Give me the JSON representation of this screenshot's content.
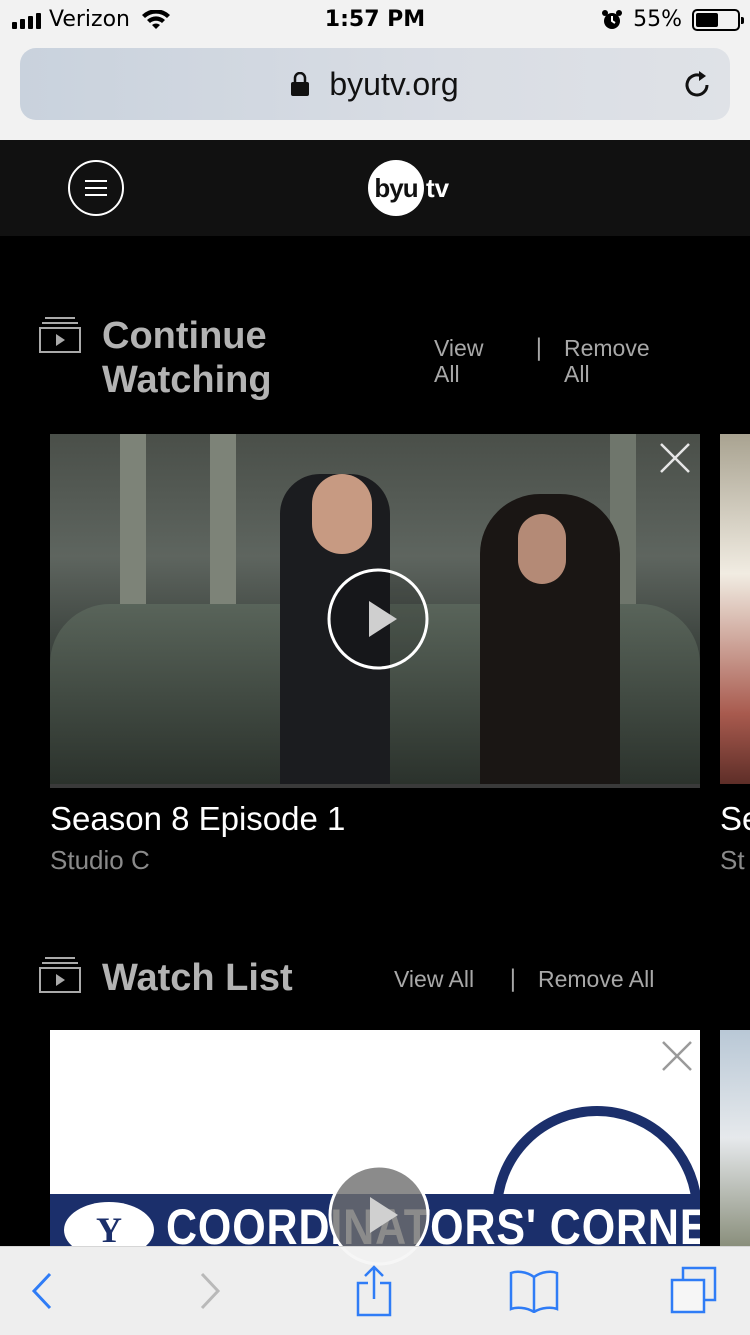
{
  "status_bar": {
    "carrier": "Verizon",
    "time": "1:57 PM",
    "battery_percent": "55%",
    "battery_level": 0.55
  },
  "browser": {
    "url": "byutv.org"
  },
  "header": {
    "logo_circle": "byu",
    "logo_suffix": "tv"
  },
  "continue_watching": {
    "title_line1": "Continue",
    "title_line2": "Watching",
    "view_all_line1": "View",
    "view_all_line2": "All",
    "separator": "|",
    "remove_all_line1": "Remove",
    "remove_all_line2": "All",
    "card": {
      "episode_title": "Season 8 Episode 1",
      "show_name": "Studio C"
    },
    "peek_card": {
      "episode_title": "Se",
      "show_name": "St"
    }
  },
  "watch_list": {
    "title": "Watch List",
    "view_all": "View All",
    "separator": "|",
    "remove_all": "Remove All",
    "card": {
      "logo_letter": "Y",
      "banner_text": "COORDINATORS' CORNER"
    }
  },
  "icons": {
    "accent": "#ffffff",
    "section_icon": "tv-stack-icon",
    "play": "play-icon",
    "close": "close-icon"
  }
}
